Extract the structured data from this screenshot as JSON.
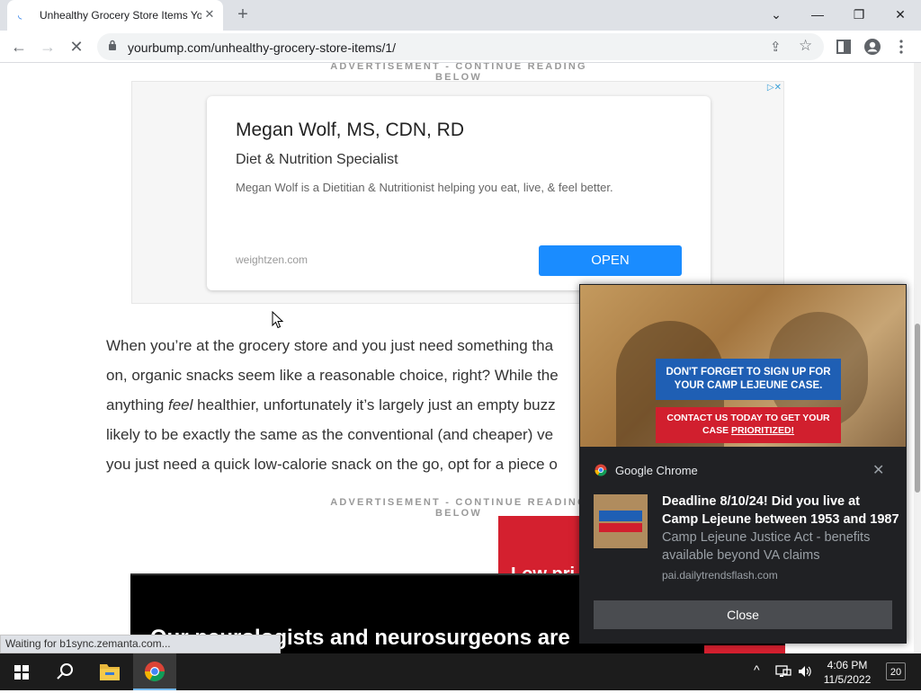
{
  "tab": {
    "title": "Unhealthy Grocery Store Items You",
    "close": "✕"
  },
  "newtab": "+",
  "window": {
    "minimize": "—",
    "restore": "❐",
    "close": "✕",
    "tabsearch": "⌄"
  },
  "toolbar": {
    "back": "←",
    "forward": "→",
    "reload": "✕"
  },
  "omnibox": {
    "url": "yourbump.com/unhealthy-grocery-store-items/1/"
  },
  "page": {
    "ad_label": "ADVERTISEMENT - CONTINUE READING BELOW",
    "ad1": {
      "name": "Megan Wolf, MS, CDN, RD",
      "role": "Diet & Nutrition Specialist",
      "description": "Megan Wolf is a Dietitian & Nutritionist helping you eat, live, & feel better.",
      "domain": "weightzen.com",
      "cta": "OPEN",
      "adchoices": "▷✕"
    },
    "article_lines": [
      "When you’re at the grocery store and you just need something tha",
      "on, organic snacks seem like a reasonable choice, right? While the",
      "anything feel healthier, unfortunately it’s largely just an empty buzz",
      "likely to be exactly the same as the conventional (and cheaper) ve",
      "you just need a quick low-calorie snack on the go, opt for a piece o"
    ],
    "ad2_text": "Low pri",
    "video_text": "Our neurologists and neurosurgeons are"
  },
  "status": "Waiting for b1sync.zemanta.com...",
  "notification": {
    "banner_top": "DON'T FORGET TO SIGN UP FOR YOUR CAMP LEJEUNE CASE.",
    "banner_bottom_1": "CONTACT US TODAY TO GET YOUR CASE ",
    "banner_bottom_2": "PRIORITIZED!",
    "source": "Google Chrome",
    "dismiss": "✕",
    "headline_1": "Deadline 8/10/24! Did you live at",
    "headline_2": "Camp Lejeune between 1953 and 1987",
    "body": "Camp Lejeune Justice Act - benefits available beyond VA claims",
    "origin": "pai.dailytrendsflash.com",
    "close": "Close"
  },
  "taskbar": {
    "time": "4:06 PM",
    "date": "11/5/2022",
    "notification_count": "20",
    "tray_arrow": "^"
  }
}
